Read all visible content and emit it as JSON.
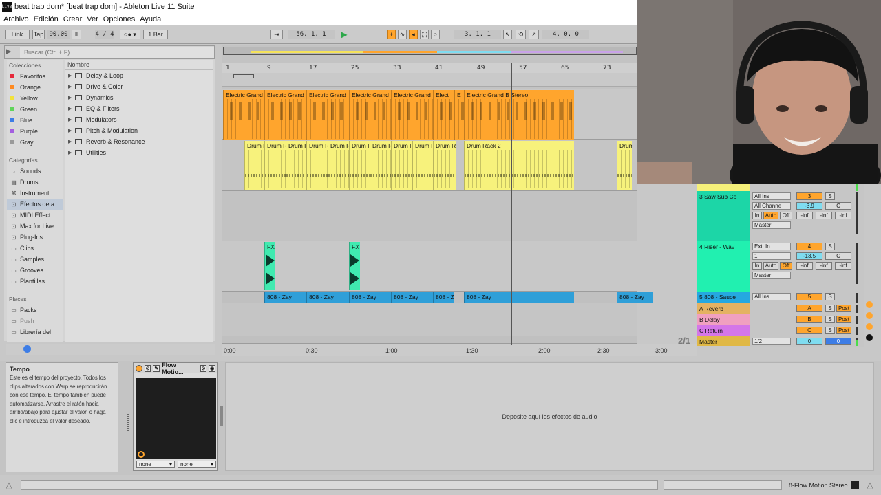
{
  "window": {
    "title": "beat trap dom* [beat trap dom] - Ableton Live 11 Suite",
    "logo": "Live"
  },
  "menu": [
    "Archivo",
    "Edición",
    "Crear",
    "Ver",
    "Opciones",
    "Ayuda"
  ],
  "control": {
    "link": "Link",
    "tap": "Tap",
    "tempo": "90.00",
    "meter": "4 / 4",
    "metronome": "1 Bar",
    "position": "56.  1.  1",
    "loop_start": "3.  1.  1",
    "loop_length": "4.  0.  0"
  },
  "browser": {
    "search_placeholder": "Buscar (Ctrl + F)",
    "colecciones_label": "Colecciones",
    "collections": [
      {
        "name": "Favoritos",
        "color": "#e6293a"
      },
      {
        "name": "Orange",
        "color": "#ff8a1f"
      },
      {
        "name": "Yellow",
        "color": "#f2e23a"
      },
      {
        "name": "Green",
        "color": "#5fd45a"
      },
      {
        "name": "Blue",
        "color": "#3d7de6"
      },
      {
        "name": "Purple",
        "color": "#a45fe0"
      },
      {
        "name": "Gray",
        "color": "#9a9a9a"
      }
    ],
    "categorias_label": "Categorías",
    "categories": [
      "Sounds",
      "Drums",
      "Instrument",
      "Efectos de a",
      "MIDI Effect",
      "Max for Live",
      "Plug-Ins",
      "Clips",
      "Samples",
      "Grooves",
      "Plantillas"
    ],
    "places_label": "Places",
    "places": [
      "Packs",
      "Push",
      "Librería del"
    ],
    "nombre_label": "Nombre",
    "folders": [
      "Delay & Loop",
      "Drive & Color",
      "Dynamics",
      "EQ & Filters",
      "Modulators",
      "Pitch & Modulation",
      "Reverb & Resonance",
      "Utilities"
    ]
  },
  "ruler": [
    "1",
    "9",
    "17",
    "25",
    "33",
    "41",
    "49",
    "57",
    "65",
    "73"
  ],
  "time_ruler": [
    "0:00",
    "0:30",
    "1:00",
    "1:30",
    "2:00",
    "2:30",
    "3:00"
  ],
  "clips": {
    "electric": [
      "Electric Grand",
      "Electric Grand",
      "Electric Grand",
      "Electric Grand",
      "Electric Grand",
      "Elect",
      "E",
      "Electric Grand B  Stereo"
    ],
    "drum": [
      "Drum R",
      "Drum R",
      "Drum R",
      "Drum R",
      "Drum R",
      "Drum R",
      "Drum R",
      "Drum R",
      "Drum R",
      "Drum R",
      "Drum Rack 2",
      "Drum"
    ],
    "fx": [
      "FX",
      "FX"
    ],
    "bass": [
      "808 - Zay",
      "808 - Zay",
      "808 - Zay",
      "808 - Zay",
      "808 - Z",
      "808 - Zay",
      "808 - Zay"
    ]
  },
  "mixer": {
    "tracks": [
      {
        "name": "3 Saw Sub Co",
        "input": "All Ins",
        "channel": "All Channe",
        "num": "3",
        "vol": "-3.9",
        "pan": "C",
        "out": "Master",
        "send1": "-inf",
        "send2": "-inf",
        "send3": "-inf",
        "monitor": [
          "In",
          "Auto",
          "Off"
        ]
      },
      {
        "name": "4 Riser - Wav",
        "input": "Ext. In",
        "channel": "1",
        "num": "4",
        "vol": "-13.5",
        "pan": "C",
        "out": "Master",
        "send1": "-inf",
        "send2": "-inf",
        "send3": "-inf",
        "monitor": [
          "In",
          "Auto",
          "Off"
        ]
      },
      {
        "name": "5 808 - Sauce",
        "input": "All Ins",
        "num": "5"
      },
      {
        "name": "A Reverb",
        "num": "A",
        "post": "Post"
      },
      {
        "name": "B Delay",
        "num": "B",
        "post": "Post"
      },
      {
        "name": "C Return",
        "num": "C",
        "post": "Post"
      },
      {
        "name": "Master",
        "channel": "1/2",
        "num": "0",
        "vol": "0"
      }
    ],
    "page": "2/1",
    "solo": "S"
  },
  "info": {
    "title": "Tempo",
    "body": "Éste es el tempo del proyecto. Todos los clips alterados con Warp se reproducirán con ese tempo. El tempo también puede automatizarse. Arrastre el ratón hacia arriba/abajo para ajustar el valor, o haga clic e introduzca el valor deseado."
  },
  "device": {
    "name": "Flow Motio...",
    "sel1": "none",
    "sel2": "none"
  },
  "dropzone": "Deposite aquí los efectos de audio",
  "status": {
    "track": "8-Flow Motion Stereo"
  }
}
